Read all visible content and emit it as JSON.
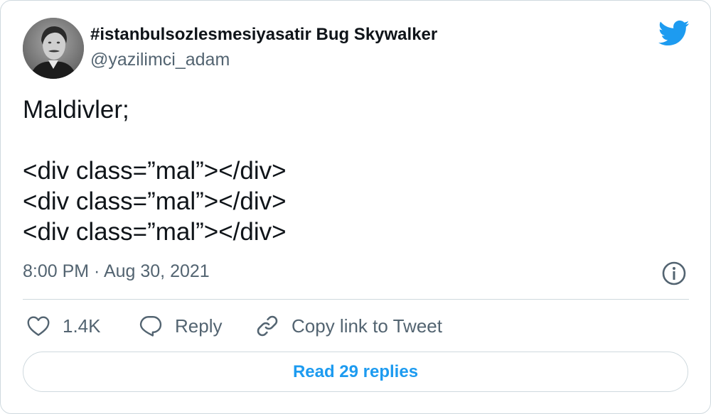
{
  "author": {
    "display_name": "#istanbulsozlesmesiyasatir Bug Skywalker",
    "handle": "@yazilimci_adam"
  },
  "tweet": {
    "text": "Maldivler;\n\n<div class=”mal”></div>\n<div class=”mal”></div>\n<div class=”mal”></div>",
    "timestamp": "8:00 PM · Aug 30, 2021"
  },
  "actions": {
    "like_count": "1.4K",
    "reply_label": "Reply",
    "copy_label": "Copy link to Tweet"
  },
  "read_replies_label": "Read 29 replies",
  "colors": {
    "accent": "#1d9bf0",
    "secondary_text": "#536471",
    "border": "#cfd9de"
  },
  "icons": [
    "twitter-bird-icon",
    "info-icon",
    "heart-icon",
    "reply-icon",
    "link-icon"
  ]
}
